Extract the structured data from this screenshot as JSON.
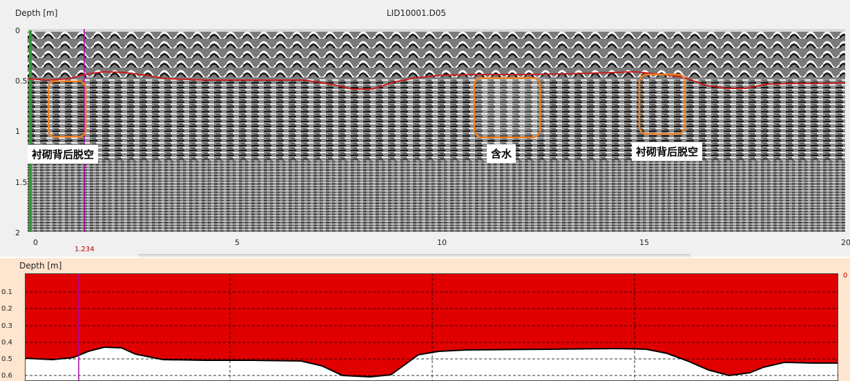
{
  "top_panel": {
    "y_label": "Depth [m]",
    "file_title": "LID10001.D05",
    "y_ticks": [
      "0",
      "0.5",
      "1",
      "1.5",
      "2"
    ],
    "x_ticks": [
      "0",
      "5",
      "10",
      "15",
      "20"
    ],
    "cursor_value": "1.234",
    "annotations": [
      "衬砌背后脱空",
      "含水",
      "衬砌背后脱空"
    ]
  },
  "bottom_panel": {
    "y_label": "Depth [m]",
    "y_ticks": [
      "0.1",
      "0.2",
      "0.3",
      "0.4",
      "0.5",
      "0.6"
    ],
    "right_value": "0"
  },
  "colors": {
    "interface_line": "#c81e1e",
    "cursor": "#b000b0",
    "highlight_box": "#f08020",
    "fill_red": "#e00000",
    "ground_marker": "#2e9e2e"
  }
}
